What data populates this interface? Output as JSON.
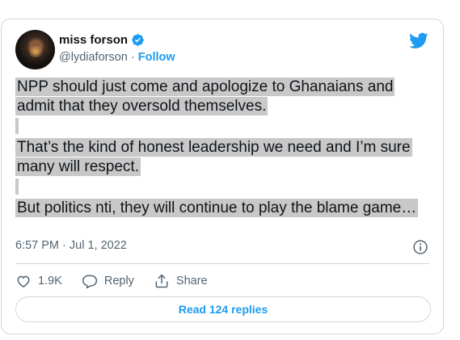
{
  "author": {
    "name": "miss forson",
    "handle": "@lydiaforson",
    "separator": " · ",
    "follow_label": "Follow",
    "verified": true
  },
  "tweet": {
    "paragraph1": "NPP should just come and apologize to Ghanaians and admit that they oversold themselves.",
    "paragraph2": "That’s the kind of honest leadership we need and I’m sure many will respect.",
    "paragraph3": "But politics nti, they will continue to play the blame game…",
    "timestamp": "6:57 PM · Jul 1, 2022"
  },
  "actions": {
    "like_count": "1.9K",
    "reply_label": "Reply",
    "share_label": "Share"
  },
  "read_replies_label": "Read 124 replies",
  "icons": [
    "verified-badge-icon",
    "twitter-bird-icon",
    "info-icon",
    "heart-icon",
    "reply-bubble-icon",
    "share-icon"
  ],
  "colors": {
    "accent": "#1d9bf0",
    "text": "#0f1419",
    "muted": "#536471",
    "highlight": "#c8c8c8",
    "border": "#cfd9de"
  }
}
